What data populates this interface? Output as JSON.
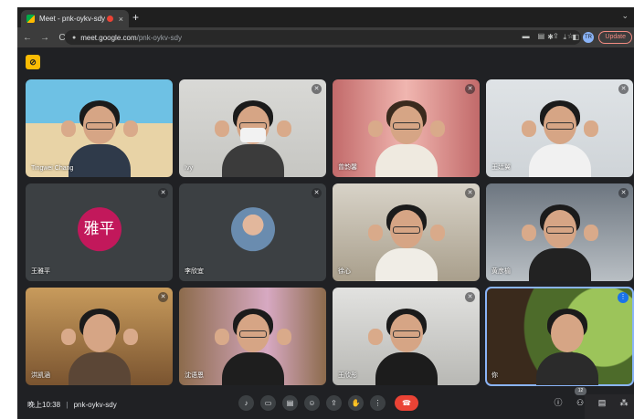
{
  "browser": {
    "tab_title": "Meet - pnk-oykv-sdy",
    "tab_close": "×",
    "new_tab": "+",
    "tab_menu": "⌄",
    "back": "←",
    "forward": "→",
    "reload": "C",
    "url_host": "meet.google.com",
    "url_path": "/pnk-oykv-sdy",
    "profile_initials": "TR",
    "update_label": "Update"
  },
  "meet": {
    "accent_color": "#8ab4f8",
    "hangup_color": "#ea4335",
    "participants": [
      {
        "name": "Tingwei Chang",
        "muted": false,
        "bg": "beach"
      },
      {
        "name": "Ivy",
        "muted": true,
        "bg": "white"
      },
      {
        "name": "曾韵馨",
        "muted": true,
        "bg": "pink"
      },
      {
        "name": "王廷翼",
        "muted": true,
        "bg": "light"
      },
      {
        "name": "王雅平",
        "muted": true,
        "bg": "avatar-text",
        "avatar_text": "雅平"
      },
      {
        "name": "李欣宜",
        "muted": true,
        "bg": "avatar-photo"
      },
      {
        "name": "徐心",
        "muted": true,
        "bg": "room"
      },
      {
        "name": "黄彦榆",
        "muted": true,
        "bg": "gray"
      },
      {
        "name": "洪凯涵",
        "muted": true,
        "bg": "western"
      },
      {
        "name": "沈语恩",
        "muted": false,
        "bg": "japanese"
      },
      {
        "name": "王欣彤",
        "muted": true,
        "bg": "office"
      },
      {
        "name": "你",
        "muted": false,
        "speaking": true,
        "bg": "hobbit"
      }
    ],
    "clock": "晚上10:38",
    "separator": "|",
    "meeting_code": "pnk-oykv-sdy",
    "people_count": "12"
  }
}
